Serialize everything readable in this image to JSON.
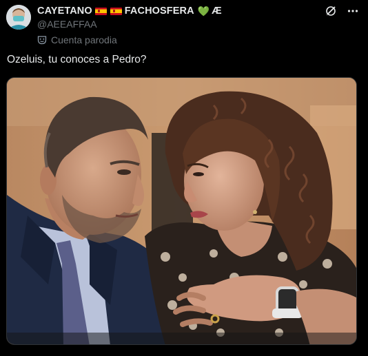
{
  "tweet": {
    "author": {
      "display_name": "CAYETANO",
      "display_name_mid": "FACHOSFERA",
      "display_name_suffix": "Æ",
      "heart_emoji": "💚",
      "handle": "@AEEAFFAA",
      "parody_label": "Cuenta parodia"
    },
    "text": "Ozeluis, tu conoces a Pedro?",
    "icons": {
      "grok": "grok-icon",
      "more": "more-icon",
      "parody": "parody-mask-icon"
    },
    "colors": {
      "background": "#000000",
      "text_primary": "#e7e9ea",
      "text_secondary": "#71767b",
      "border": "#2f3336"
    }
  }
}
